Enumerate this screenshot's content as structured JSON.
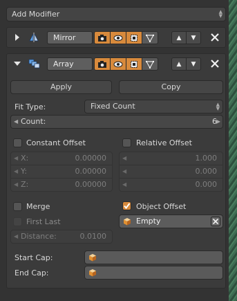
{
  "add_modifier_label": "Add Modifier",
  "modifiers": [
    {
      "name": "Mirror",
      "icon": "mirror-modifier-icon",
      "expanded": false
    },
    {
      "name": "Array",
      "icon": "array-modifier-icon",
      "expanded": true
    }
  ],
  "array": {
    "apply_label": "Apply",
    "copy_label": "Copy",
    "fit_type_label": "Fit Type:",
    "fit_type_value": "Fixed Count",
    "count_label": "Count:",
    "count_value": "6",
    "constant_offset_label": "Constant Offset",
    "relative_offset_label": "Relative Offset",
    "constant": {
      "x_label": "X:",
      "x_value": "0.00000",
      "y_label": "Y:",
      "y_value": "0.00000",
      "z_label": "Z:",
      "z_value": "0.00000"
    },
    "relative": {
      "x_value": "1.000",
      "y_value": "0.000",
      "z_value": "0.000"
    },
    "merge_label": "Merge",
    "first_last_label": "First Last",
    "distance_label": "Distance:",
    "distance_value": "0.0100",
    "object_offset_label": "Object Offset",
    "object_offset_checked": true,
    "offset_object": "Empty",
    "start_cap_label": "Start Cap:",
    "end_cap_label": "End Cap:"
  },
  "colors": {
    "accent": "#d88a3c",
    "panel": "#333333",
    "field": "#5a5a5a"
  }
}
